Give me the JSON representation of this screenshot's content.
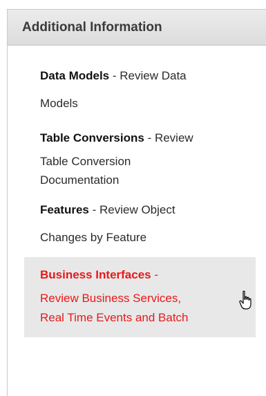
{
  "panel": {
    "title": "Additional Information"
  },
  "items": [
    {
      "title": "Data Models",
      "line1_rest": " - Review Data",
      "line2": "Models"
    },
    {
      "title": "Table Conversions",
      "line1_rest": " - Review",
      "line2": "Table Conversion",
      "line3": "Documentation"
    },
    {
      "title": "Features",
      "line1_rest": " - Review Object",
      "line2": "Changes by Feature"
    },
    {
      "title": "Business Interfaces",
      "line1_rest": " -",
      "line2": "Review Business Services,",
      "line3": "Real Time Events and Batch"
    }
  ],
  "colors": {
    "active_link": "#e8191b",
    "active_background": "#e8e8e8",
    "header_background": "#e4e4e4",
    "text": "#2b2b2b"
  },
  "icons": {
    "cursor": "hand-pointer-icon"
  }
}
